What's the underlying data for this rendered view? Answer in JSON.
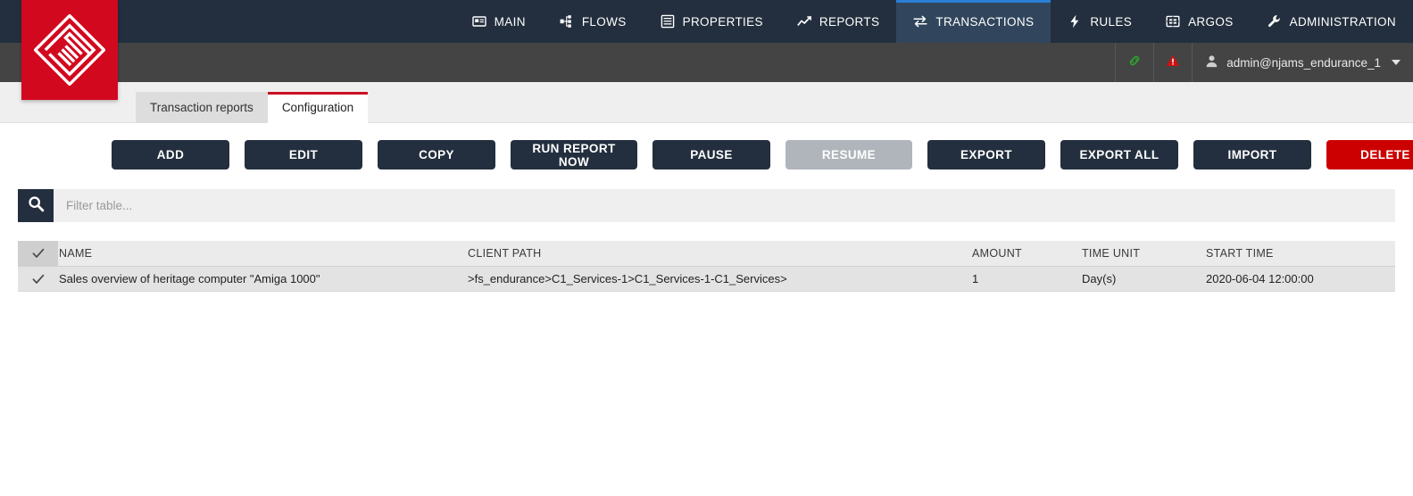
{
  "brand": {
    "logo_name": "njams-logo",
    "logo_color": "#d2081e"
  },
  "topnav": {
    "items": [
      {
        "label": "MAIN",
        "icon": "card-icon",
        "active": false
      },
      {
        "label": "FLOWS",
        "icon": "flows-icon",
        "active": false
      },
      {
        "label": "PROPERTIES",
        "icon": "list-icon",
        "active": false
      },
      {
        "label": "REPORTS",
        "icon": "chart-icon",
        "active": false
      },
      {
        "label": "TRANSACTIONS",
        "icon": "exchange-icon",
        "active": true
      },
      {
        "label": "RULES",
        "icon": "bolt-icon",
        "active": false
      },
      {
        "label": "ARGOS",
        "icon": "argos-icon",
        "active": false
      },
      {
        "label": "ADMINISTRATION",
        "icon": "wrench-icon",
        "active": false
      }
    ],
    "active_accent": "#2a7fd4"
  },
  "userbar": {
    "link_icon": "link-icon",
    "link_color": "#2ea32e",
    "warning_icon": "warning-triangle-icon",
    "warning_color": "#cc1111",
    "user_icon": "user-icon",
    "username": "admin@njams_endurance_1",
    "chevron_icon": "chevron-down-icon"
  },
  "tabs": {
    "items": [
      {
        "label": "Transaction reports",
        "active": false
      },
      {
        "label": "Configuration",
        "active": true
      }
    ],
    "active_accent": "#cc1122"
  },
  "toolbar": {
    "buttons": [
      {
        "label": "ADD",
        "state": "enabled",
        "style": "default"
      },
      {
        "label": "EDIT",
        "state": "enabled",
        "style": "default"
      },
      {
        "label": "COPY",
        "state": "enabled",
        "style": "default"
      },
      {
        "label": "RUN REPORT NOW",
        "state": "enabled",
        "style": "default"
      },
      {
        "label": "PAUSE",
        "state": "enabled",
        "style": "default"
      },
      {
        "label": "RESUME",
        "state": "disabled",
        "style": "disabled"
      },
      {
        "label": "EXPORT",
        "state": "enabled",
        "style": "default"
      },
      {
        "label": "EXPORT ALL",
        "state": "enabled",
        "style": "default"
      },
      {
        "label": "IMPORT",
        "state": "enabled",
        "style": "default"
      },
      {
        "label": "DELETE",
        "state": "enabled",
        "style": "danger"
      }
    ],
    "danger_color": "#cc0000",
    "default_color": "#232f3e",
    "disabled_color": "#b0b5bb"
  },
  "filter": {
    "icon": "search-icon",
    "placeholder": "Filter table...",
    "value": ""
  },
  "table": {
    "select_all_checked": true,
    "columns": [
      "NAME",
      "CLIENT PATH",
      "AMOUNT",
      "TIME UNIT",
      "START TIME"
    ],
    "rows": [
      {
        "checked": true,
        "name": "Sales overview of heritage computer \"Amiga 1000\"",
        "client_path": ">fs_endurance>C1_Services-1>C1_Services-1-C1_Services>",
        "amount": "1",
        "time_unit": "Day(s)",
        "start_time": "2020-06-04 12:00:00"
      }
    ]
  }
}
